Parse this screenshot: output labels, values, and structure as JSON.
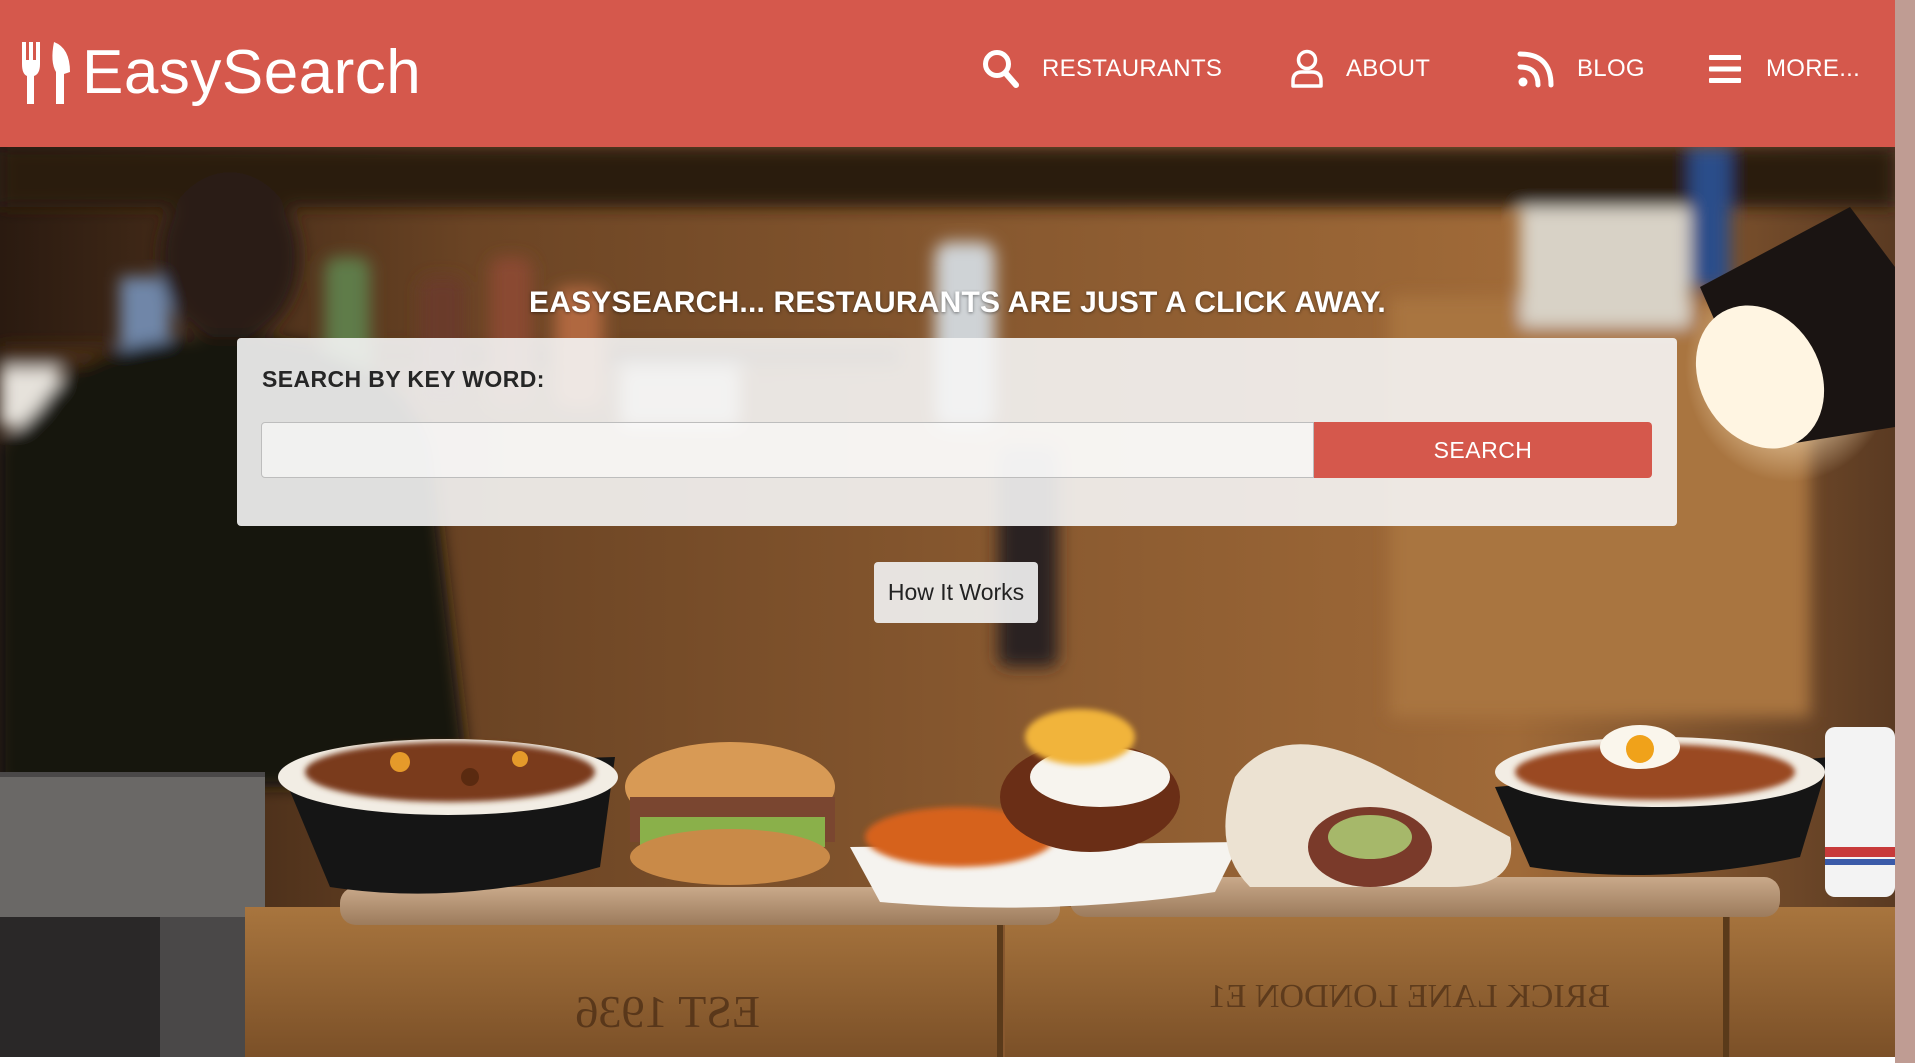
{
  "brand": {
    "name": "EasySearch",
    "icon": "fork-knife-icon"
  },
  "nav": {
    "items": [
      {
        "label": "RESTAURANTS",
        "icon": "search-icon"
      },
      {
        "label": "ABOUT",
        "icon": "user-icon"
      },
      {
        "label": "BLOG",
        "icon": "rss-icon"
      },
      {
        "label": "MORE...",
        "icon": "hamburger-menu-icon"
      }
    ]
  },
  "hero": {
    "headline": "EASYSEARCH... RESTAURANTS ARE JUST A CLICK AWAY.",
    "search": {
      "label": "SEARCH BY KEY WORD:",
      "value": "",
      "placeholder": "",
      "button_label": "SEARCH"
    },
    "how_it_works_label": "How It Works",
    "background_image": "restaurant-counter-food-photo",
    "crate_text_left": "EST 1936",
    "crate_text_right": "BRICK LANE LONDON E1"
  },
  "colors": {
    "primary": "#d5584c",
    "header_text": "#ffffff",
    "panel_bg": "#f5f5f5"
  }
}
